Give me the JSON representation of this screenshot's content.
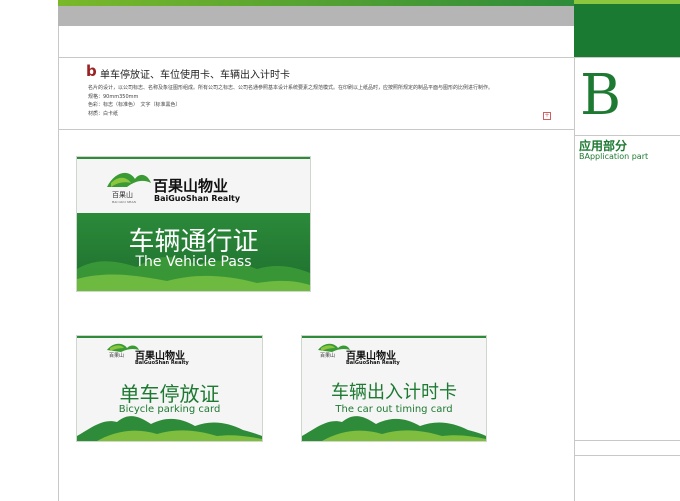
{
  "sidebar": {
    "letter": "B",
    "category_cn": "应用部分",
    "category_en": "BApplication part"
  },
  "section": {
    "letter": "b",
    "title": "单车停放证、车位使用卡、车辆出入计时卡",
    "desc": [
      "名片的设计，以公司标志、名称及象征图形组成。所有公司之标志、公司名通参照基本设计系统要素之规范模式。在印刷以上纸品时，应按照所规定的制品平面与图形的比例进行制作。",
      "规格：90mm350mm",
      "色彩：标志（标准色）　文字（标准黑色）",
      "材质：白卡纸"
    ],
    "plus": "+"
  },
  "colors": {
    "brand_green": "#1e7a32",
    "light_green": "#8cc63f",
    "accent_red": "#9a2222"
  },
  "cards": [
    {
      "brand_cn": "百果山物业",
      "brand_en": "BaiGuoShan Realty",
      "seal": "百果山",
      "seal_sub": "BAI GUO SHAN",
      "title_cn": "车辆通行证",
      "title_en": "The Vehicle Pass"
    },
    {
      "brand_cn": "百果山物业",
      "brand_en": "BaiGuoShan Realty",
      "seal": "百果山",
      "title_cn": "单车停放证",
      "title_en": "Bicycle parking card"
    },
    {
      "brand_cn": "百果山物业",
      "brand_en": "BaiGuoShan Realty",
      "seal": "百果山",
      "title_cn": "车辆出入计时卡",
      "title_en": "The car out timing card"
    }
  ]
}
